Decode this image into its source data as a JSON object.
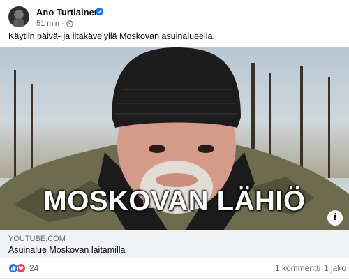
{
  "post": {
    "author": "Ano Turtiainen",
    "time": "51 min",
    "separator": "·",
    "text": "Käytiin päivä- ja iltakävelyllä Moskovan asuinalueella."
  },
  "media": {
    "caption": "MOSKOVAN LÄHIÖ",
    "info_glyph": "i"
  },
  "link": {
    "domain": "YOUTUBE.COM",
    "title": "Asuinalue Moskovan laitamilla"
  },
  "stats": {
    "reaction_count": "24",
    "comments": "1 kommentti",
    "shares": "1 jako"
  },
  "icons": {
    "verified": "verified-badge-icon",
    "audience": "globe-icon",
    "more": "more-options-icon",
    "like": "like-icon",
    "love": "love-icon",
    "info": "info-icon"
  },
  "colors": {
    "facebook_blue": "#1877f2",
    "love_red": "#f33e58",
    "secondary_text": "#65676b",
    "link_bg": "#f0f2f5"
  }
}
